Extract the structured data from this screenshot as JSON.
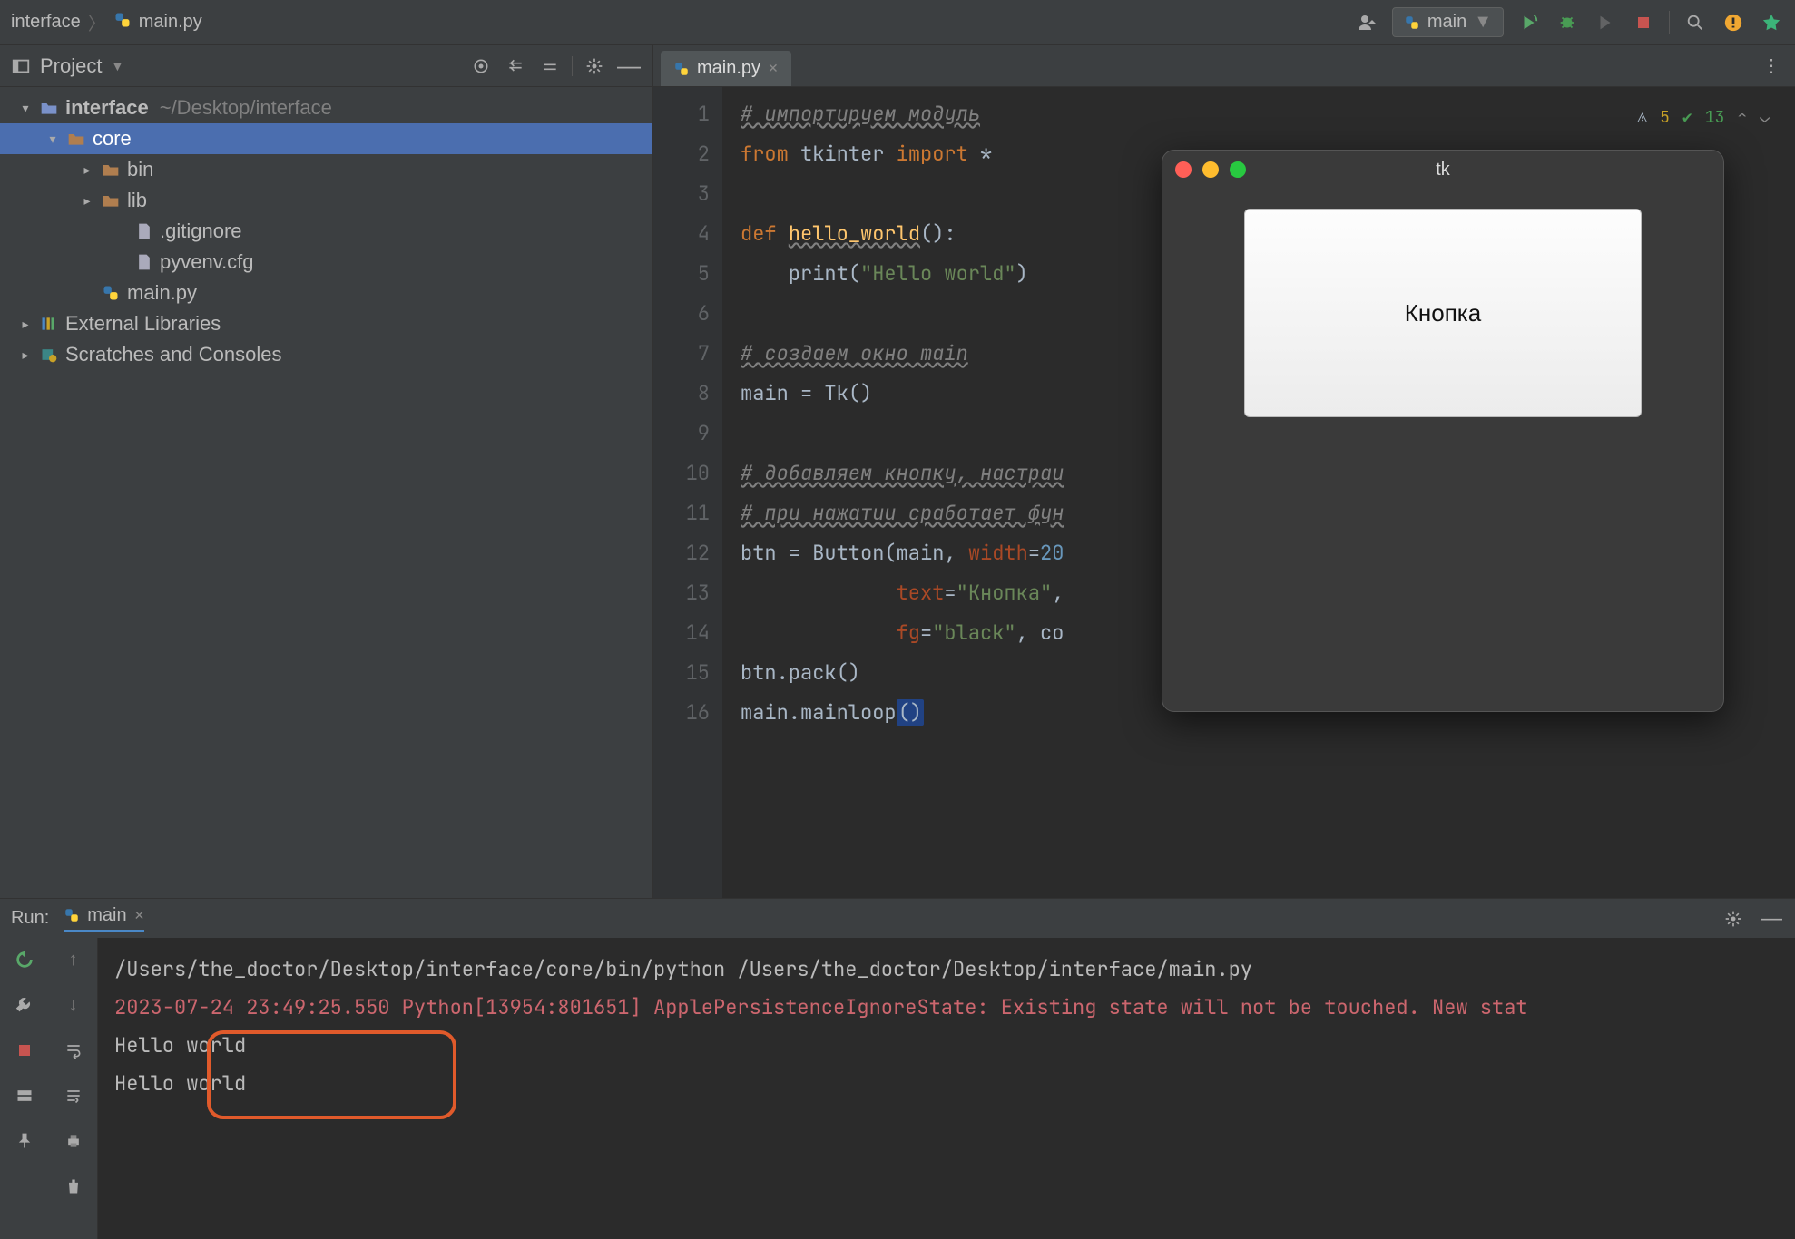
{
  "breadcrumbs": {
    "root": "interface",
    "file": "main.py"
  },
  "runConfig": {
    "label": "main"
  },
  "sidebar": {
    "title": "Project",
    "tree": [
      {
        "label": "interface",
        "path": "~/Desktop/interface",
        "icon": "folder-root",
        "chev": "▾",
        "indent": 0
      },
      {
        "label": "core",
        "icon": "folder",
        "chev": "▾",
        "indent": 1,
        "selected": true
      },
      {
        "label": "bin",
        "icon": "folder",
        "chev": "▸",
        "indent": 2
      },
      {
        "label": "lib",
        "icon": "folder",
        "chev": "▸",
        "indent": 2
      },
      {
        "label": ".gitignore",
        "icon": "file",
        "chev": "",
        "indent": 3
      },
      {
        "label": "pyvenv.cfg",
        "icon": "file",
        "chev": "",
        "indent": 3
      },
      {
        "label": "main.py",
        "icon": "pyfile",
        "chev": "",
        "indent": 2
      },
      {
        "label": "External Libraries",
        "icon": "libs",
        "chev": "▸",
        "indent": 0
      },
      {
        "label": "Scratches and Consoles",
        "icon": "scratch",
        "chev": "▸",
        "indent": 0
      }
    ]
  },
  "tab": {
    "label": "main.py"
  },
  "inspections": {
    "warn": "5",
    "ok": "13"
  },
  "code": {
    "lines": [
      "1",
      "2",
      "3",
      "4",
      "5",
      "6",
      "7",
      "8",
      "9",
      "10",
      "11",
      "12",
      "13",
      "14",
      "15",
      "16"
    ],
    "l1a": "# импортируем модуль",
    "l2a": "from",
    "l2b": " tkinter ",
    "l2c": "import",
    "l2d": " *",
    "l4a": "def ",
    "l4b": "hello_world",
    "l4c": "():",
    "l5a": "    print(",
    "l5b": "\"Hello world\"",
    "l5c": ")",
    "l7a": "# создаем окно main",
    "l8a": "main = Tk()",
    "l10a": "# добавляем кнопку, настраи",
    "l11a": "# при нажатии сработает фун",
    "l12a": "btn = Button(main, ",
    "l12b": "width",
    "l12c": "=",
    "l12d": "20",
    "l13a": "             ",
    "l13b": "text",
    "l13c": "=",
    "l13d": "\"Кнопка\"",
    "l13e": ",",
    "l14a": "             ",
    "l14b": "fg",
    "l14c": "=",
    "l14d": "\"black\"",
    "l14e": ", co",
    "l15a": "btn.pack()",
    "l16a": "main.mainloop",
    "l16b": "()"
  },
  "tk": {
    "title": "tk",
    "button": "Кнопка"
  },
  "run": {
    "title": "Run:",
    "tab": "main",
    "cmd": "/Users/the_doctor/Desktop/interface/core/bin/python /Users/the_doctor/Desktop/interface/main.py",
    "warn": "2023-07-24 23:49:25.550 Python[13954:801651] ApplePersistenceIgnoreState: Existing state will not be touched. New stat",
    "out1": "Hello world",
    "out2": "Hello world"
  }
}
